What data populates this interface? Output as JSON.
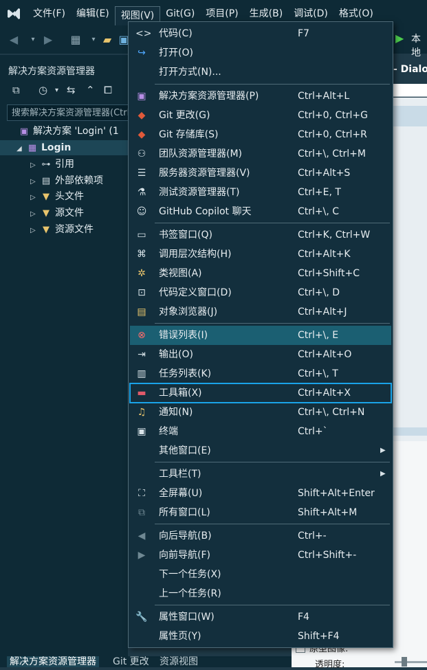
{
  "menubar": {
    "items": [
      "文件(F)",
      "编辑(E)",
      "视图(V)",
      "Git(G)",
      "项目(P)",
      "生成(B)",
      "调试(D)",
      "格式(O)"
    ],
    "active_index": 2
  },
  "toolbar": {
    "run_label": "本地"
  },
  "solution_explorer": {
    "title": "解决方案资源管理器",
    "search_placeholder": "搜索解决方案资源管理器(Ctrl+;)",
    "tree": [
      {
        "label": "解决方案 'Login' (1",
        "icon": "solution-icon"
      },
      {
        "label": "Login",
        "icon": "project-icon"
      },
      {
        "label": "引用",
        "icon": "references-icon"
      },
      {
        "label": "外部依赖项",
        "icon": "external-deps-icon"
      },
      {
        "label": "头文件",
        "icon": "folder-icon"
      },
      {
        "label": "源文件",
        "icon": "folder-icon"
      },
      {
        "label": "资源文件",
        "icon": "folder-icon"
      }
    ]
  },
  "right_pane": {
    "title": "- Dialog",
    "props_label1": "原型图像:",
    "props_label2": "透明度:"
  },
  "bottom_tabs": [
    "解决方案资源管理器",
    "Git 更改",
    "资源视图"
  ],
  "view_menu": {
    "items": [
      {
        "label": "代码(C)",
        "shortcut": "F7",
        "icon": "code-icon"
      },
      {
        "label": "打开(O)",
        "shortcut": "",
        "icon": "open-icon"
      },
      {
        "label": "打开方式(N)...",
        "shortcut": "",
        "icon": ""
      },
      {
        "label": "解决方案资源管理器(P)",
        "shortcut": "Ctrl+Alt+L",
        "icon": "solution-explorer-icon"
      },
      {
        "label": "Git 更改(G)",
        "shortcut": "Ctrl+0, Ctrl+G",
        "icon": "git-changes-icon"
      },
      {
        "label": "Git 存储库(S)",
        "shortcut": "Ctrl+0, Ctrl+R",
        "icon": "git-repo-icon"
      },
      {
        "label": "团队资源管理器(M)",
        "shortcut": "Ctrl+\\, Ctrl+M",
        "icon": "team-explorer-icon"
      },
      {
        "label": "服务器资源管理器(V)",
        "shortcut": "Ctrl+Alt+S",
        "icon": "server-explorer-icon"
      },
      {
        "label": "测试资源管理器(T)",
        "shortcut": "Ctrl+E, T",
        "icon": "test-explorer-icon"
      },
      {
        "label": "GitHub Copilot 聊天",
        "shortcut": "Ctrl+\\, C",
        "icon": "copilot-icon"
      },
      {
        "label": "书签窗口(Q)",
        "shortcut": "Ctrl+K, Ctrl+W",
        "icon": "bookmark-icon"
      },
      {
        "label": "调用层次结构(H)",
        "shortcut": "Ctrl+Alt+K",
        "icon": "call-hierarchy-icon"
      },
      {
        "label": "类视图(A)",
        "shortcut": "Ctrl+Shift+C",
        "icon": "class-view-icon"
      },
      {
        "label": "代码定义窗口(D)",
        "shortcut": "Ctrl+\\, D",
        "icon": "code-definition-icon"
      },
      {
        "label": "对象浏览器(J)",
        "shortcut": "Ctrl+Alt+J",
        "icon": "object-browser-icon"
      },
      {
        "label": "错误列表(I)",
        "shortcut": "Ctrl+\\, E",
        "icon": "error-list-icon"
      },
      {
        "label": "输出(O)",
        "shortcut": "Ctrl+Alt+O",
        "icon": "output-icon"
      },
      {
        "label": "任务列表(K)",
        "shortcut": "Ctrl+\\, T",
        "icon": "task-list-icon"
      },
      {
        "label": "工具箱(X)",
        "shortcut": "Ctrl+Alt+X",
        "icon": "toolbox-icon"
      },
      {
        "label": "通知(N)",
        "shortcut": "Ctrl+\\, Ctrl+N",
        "icon": "bell-icon"
      },
      {
        "label": "终端",
        "shortcut": "Ctrl+`",
        "icon": "terminal-icon"
      },
      {
        "label": "其他窗口(E)",
        "shortcut": "",
        "icon": ""
      },
      {
        "label": "工具栏(T)",
        "shortcut": "",
        "icon": ""
      },
      {
        "label": "全屏幕(U)",
        "shortcut": "Shift+Alt+Enter",
        "icon": "fullscreen-icon"
      },
      {
        "label": "所有窗口(L)",
        "shortcut": "Shift+Alt+M",
        "icon": "all-windows-icon"
      },
      {
        "label": "向后导航(B)",
        "shortcut": "Ctrl+-",
        "icon": "nav-back-icon"
      },
      {
        "label": "向前导航(F)",
        "shortcut": "Ctrl+Shift+-",
        "icon": "nav-forward-icon"
      },
      {
        "label": "下一个任务(X)",
        "shortcut": "",
        "icon": ""
      },
      {
        "label": "上一个任务(R)",
        "shortcut": "",
        "icon": ""
      },
      {
        "label": "属性窗口(W)",
        "shortcut": "F4",
        "icon": "wrench-icon"
      },
      {
        "label": "属性页(Y)",
        "shortcut": "Shift+F4",
        "icon": ""
      }
    ],
    "highlighted_index": 15,
    "boxed_index": 18
  }
}
